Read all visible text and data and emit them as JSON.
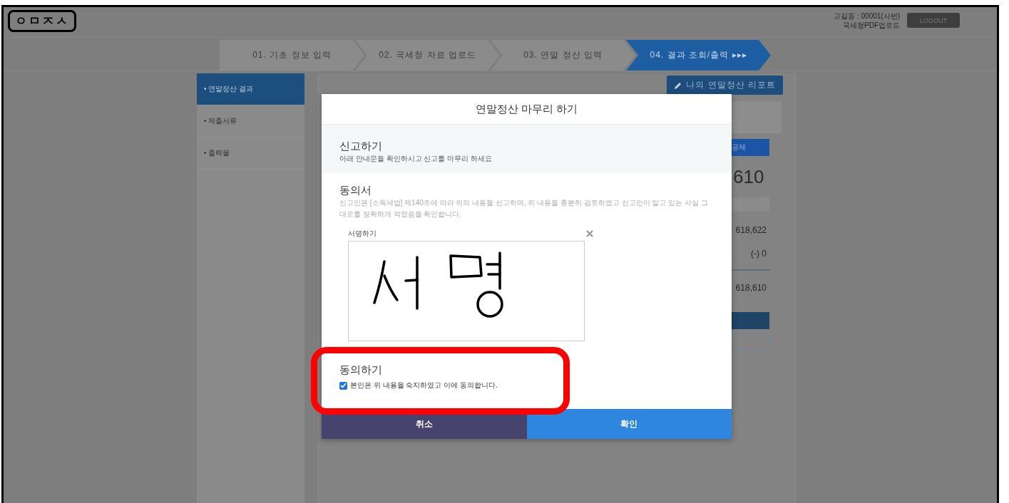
{
  "header": {
    "logo": "ㅇㅁㅈㅅ",
    "user": "고길동 : 00001(사번)",
    "upload_link": "국세청PDF업로드",
    "logout": "LOGOUT"
  },
  "steps": [
    {
      "label": "01. 기초 정보 입력",
      "selected": false
    },
    {
      "label": "02. 국세청 자료 업로드",
      "selected": false
    },
    {
      "label": "03. 연말 정산 입력",
      "selected": false
    },
    {
      "label": "04. 결과 조회/출력",
      "selected": true,
      "suffix": "▸▸▸"
    }
  ],
  "sidebar": {
    "items": [
      {
        "label": "• 연말정산 결과",
        "selected": true
      },
      {
        "label": "• 제출서류",
        "selected": false
      },
      {
        "label": "• 출력물",
        "selected": false
      }
    ]
  },
  "background": {
    "report_button": "나의 연말정산 리포트",
    "deduction_tab": "공제",
    "amount": "610",
    "rows": [
      "618,622",
      "(-) 0"
    ],
    "total": "618,610"
  },
  "dialog": {
    "title": "연말정산 마무리 하기",
    "report": {
      "heading": "신고하기",
      "text": "아래 안내문을 확인하시고 신고를 마무리 하세요"
    },
    "consent": {
      "heading": "동의서",
      "text": "신고인은 [소득세법] 제140조에 따라 위의 내용을 신고하며, 위 내용을 충분히 검토하였고 신고인이 알고 있는 사실 그대로를 정확하게 적었음을 확인합니다.",
      "signature_label": "서명하기",
      "signed": true
    },
    "agree": {
      "heading": "동의하기",
      "label": "본인은 위 내용을 숙지하였고 이에 동의합니다.",
      "checked": true,
      "highlighted": true
    },
    "buttons": [
      {
        "label": "취소",
        "kind": "cancel"
      },
      {
        "label": "확인",
        "kind": "confirm"
      }
    ]
  }
}
